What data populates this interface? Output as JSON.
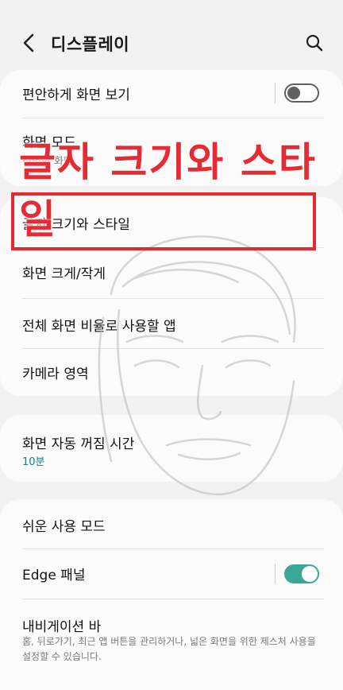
{
  "header": {
    "back_icon": "arrow-left-icon",
    "title": "디스플레이",
    "search_icon": "search-icon"
  },
  "card1": {
    "easy_view": {
      "label": "편안하게 화면 보기",
      "toggle_on": false
    },
    "screen_mode": {
      "label": "화면 모드",
      "sub": "선명한 화면"
    }
  },
  "card2": {
    "font_style": "글자 크기와 스타일",
    "zoom": "화면 크게/작게",
    "fullscreen_apps": "전체 화면 비율로 사용할 앱",
    "camera_cutout": "카메라 영역"
  },
  "card3": {
    "timeout": {
      "label": "화면 자동 꺼짐 시간",
      "value": "10분"
    }
  },
  "card4": {
    "easy_mode": "쉬운 사용 모드",
    "edge_panels": {
      "label": "Edge 패널",
      "toggle_on": true
    },
    "navigation_bar": {
      "label": "내비게이션 바",
      "desc": "홈, 뒤로가기, 최근 앱 버튼을 관리하거나, 넓은 화면을 위한 제스처 사용을 설정할 수 있습니다."
    }
  },
  "annotation": {
    "overlay_text": "글자 크기와 스타일",
    "highlight_color": "#e02b33"
  },
  "colors": {
    "accent_teal": "#3aa894",
    "subtext_teal": "#1c7a86",
    "background": "#f2f2f2"
  }
}
